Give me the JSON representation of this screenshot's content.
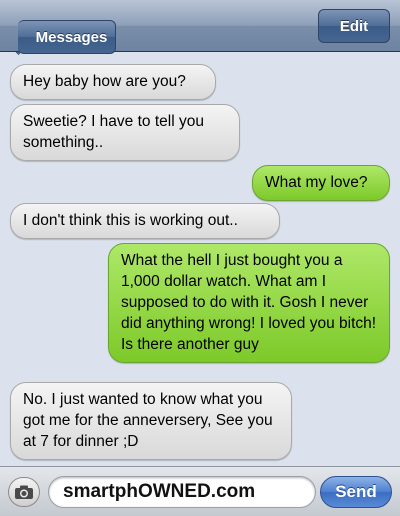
{
  "navbar": {
    "back_label": "Messages",
    "edit_label": "Edit"
  },
  "messages": [
    {
      "side": "received",
      "text": "Hey baby how are you?"
    },
    {
      "side": "received",
      "text": "Sweetie? I have to tell you something.."
    },
    {
      "side": "sent",
      "text": "What my love?"
    },
    {
      "side": "received",
      "text": "I don't think this is working out.."
    },
    {
      "side": "sent",
      "text": "What the hell I just bought you a 1,000 dollar watch. What am I supposed to do with it. Gosh I never did anything wrong! I loved you bitch! Is there another guy"
    },
    {
      "side": "received",
      "text": "No. I just wanted to know what you got me for the anneversery, See you at 7 for dinner ;D"
    }
  ],
  "composer": {
    "input_value": "smartphOWNED.com",
    "send_label": "Send",
    "camera_icon": "camera-icon"
  },
  "colors": {
    "sent_bubble": "#8fd43f",
    "received_bubble": "#e6e6e6",
    "background": "#dbe2ed",
    "navbar": "#8d9fb8",
    "send_button": "#4c7fd0"
  }
}
